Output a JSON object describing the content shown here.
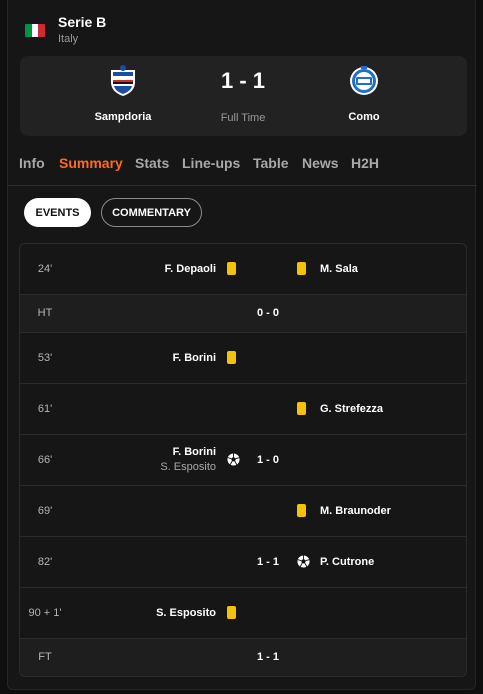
{
  "league": {
    "name": "Serie B",
    "country": "Italy",
    "flag_colors": [
      "#009246",
      "#ffffff",
      "#ce2b37"
    ]
  },
  "match": {
    "home_team": "Sampdoria",
    "away_team": "Como",
    "score": "1 - 1",
    "status": "Full Time",
    "home_crest_icon": "sampdoria-crest-icon",
    "away_crest_icon": "como-crest-icon"
  },
  "tabs": [
    {
      "label": "Info",
      "active": false
    },
    {
      "label": "Summary",
      "active": true
    },
    {
      "label": "Stats",
      "active": false
    },
    {
      "label": "Line-ups",
      "active": false
    },
    {
      "label": "Table",
      "active": false
    },
    {
      "label": "News",
      "active": false
    },
    {
      "label": "H2H",
      "active": false
    }
  ],
  "filters": {
    "events": "EVENTS",
    "commentary": "COMMENTARY"
  },
  "events": [
    {
      "minute": "24'",
      "home_player": "F. Depaoli",
      "home_icon": "yellow-card-icon",
      "away_player": "M. Sala",
      "away_icon": "yellow-card-icon"
    },
    {
      "minute": "HT",
      "score": "0 - 0"
    },
    {
      "minute": "53'",
      "home_player": "F. Borini",
      "home_icon": "yellow-card-icon"
    },
    {
      "minute": "61'",
      "away_player": "G. Strefezza",
      "away_icon": "yellow-card-icon"
    },
    {
      "minute": "66'",
      "home_player": "F. Borini",
      "home_assist": "S. Esposito",
      "home_icon": "goal-ball-icon",
      "score": "1 - 0"
    },
    {
      "minute": "69'",
      "away_player": "M. Braunoder",
      "away_icon": "yellow-card-icon"
    },
    {
      "minute": "82'",
      "score": "1 - 1",
      "away_player": "P. Cutrone",
      "away_icon": "goal-ball-icon"
    },
    {
      "minute": "90 + 1'",
      "home_player": "S. Esposito",
      "home_icon": "yellow-card-icon"
    },
    {
      "minute": "FT",
      "score": "1 - 1"
    }
  ],
  "colors": {
    "accent": "#ff6a1c",
    "yellow_card": "#f4c20d",
    "background": "#161616",
    "card_background": "#222222"
  }
}
